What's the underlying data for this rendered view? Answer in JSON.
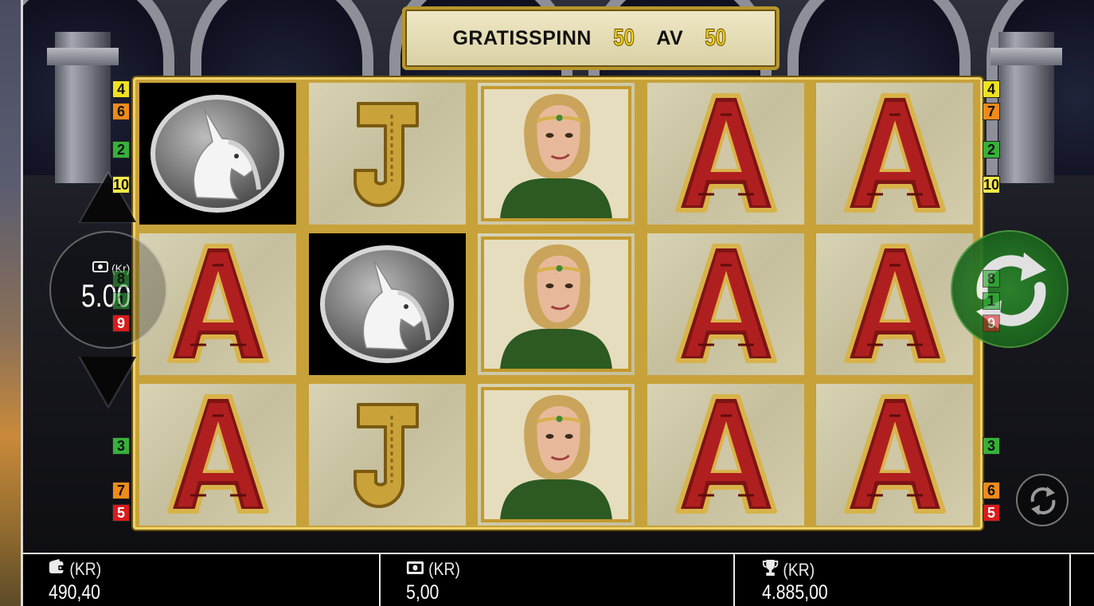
{
  "header": {
    "label": "GRATISSPINN",
    "current_spin": "50",
    "of_word": "AV",
    "total_spins": "50"
  },
  "reels": [
    [
      "unicorn",
      "A",
      "A"
    ],
    [
      "J",
      "unicorn",
      "J"
    ],
    [
      "portrait",
      "portrait",
      "portrait"
    ],
    [
      "A",
      "A",
      "A"
    ],
    [
      "A",
      "A",
      "A"
    ]
  ],
  "paylines": {
    "left": [
      "4",
      "6",
      "2",
      "10",
      "8",
      "1",
      "9",
      "3",
      "7",
      "5"
    ],
    "right": [
      "4",
      "7",
      "2",
      "10",
      "8",
      "1",
      "9",
      "3",
      "6",
      "5"
    ]
  },
  "bet_control": {
    "currency_label": "(Kr)",
    "value": "5.00"
  },
  "bottom_bar": {
    "balance": {
      "currency": "(KR)",
      "value": "490,40"
    },
    "bet": {
      "currency": "(KR)",
      "value": "5,00"
    },
    "win": {
      "currency": "(KR)",
      "value": "4.885,00"
    }
  },
  "icons": {
    "balance": "wallet-icon",
    "bet": "banknote-icon",
    "win": "trophy-icon",
    "spin": "refresh-icon",
    "autoplay": "autoplay-icon",
    "bet_up": "triangle-up-icon",
    "bet_down": "triangle-down-icon"
  },
  "colors": {
    "plaque_number": "#f3d21a",
    "spin_button": "#1e6b20",
    "board_frame": "#c7a23a"
  }
}
